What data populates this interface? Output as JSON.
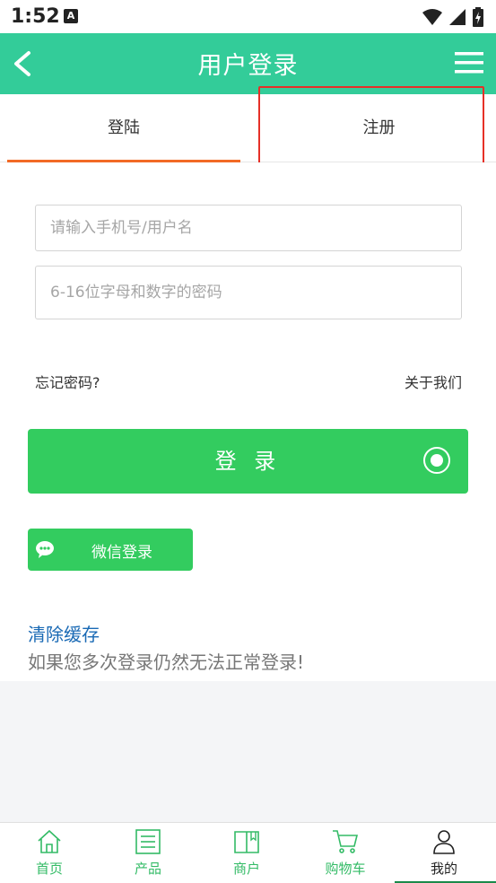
{
  "status_bar": {
    "time": "1:52",
    "notification_icon": "A"
  },
  "header": {
    "title": "用户登录"
  },
  "tabs": [
    {
      "label": "登陆",
      "active": true
    },
    {
      "label": "注册",
      "active": false
    }
  ],
  "form": {
    "phone_placeholder": "请输入手机号/用户名",
    "password_placeholder": "6-16位字母和数字的密码",
    "forgot_password": "忘记密码?",
    "about_us": "关于我们",
    "login_button": "登 录",
    "wechat_button": "微信登录"
  },
  "cache": {
    "clear_link": "清除缓存",
    "hint": "如果您多次登录仍然无法正常登录!"
  },
  "bottom_nav": [
    {
      "label": "首页",
      "icon": "home-icon"
    },
    {
      "label": "产品",
      "icon": "list-icon"
    },
    {
      "label": "商户",
      "icon": "book-icon"
    },
    {
      "label": "购物车",
      "icon": "cart-icon"
    },
    {
      "label": "我的",
      "icon": "user-icon",
      "active": true
    }
  ],
  "colors": {
    "primary": "#33cc99",
    "button": "#33cc5f",
    "tab_indicator": "#f26a25",
    "link": "#1a6ab5",
    "highlight": "#e63027"
  }
}
